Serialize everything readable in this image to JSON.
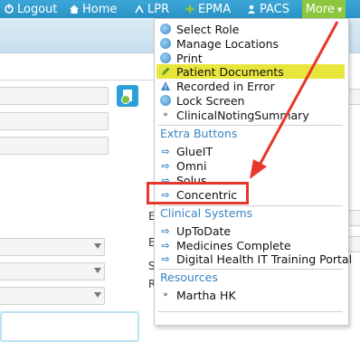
{
  "topnav": {
    "items": [
      {
        "label": "Logout",
        "icon": "logout-icon"
      },
      {
        "label": "Home",
        "icon": "home-icon"
      },
      {
        "label": "LPR",
        "icon": "lpr-icon"
      },
      {
        "label": "EPMA",
        "icon": "plus-icon"
      },
      {
        "label": "PACS",
        "icon": "pacs-icon"
      }
    ],
    "more_label": "More"
  },
  "background": {
    "letters": [
      "E",
      "E",
      "S",
      "R"
    ]
  },
  "menu": {
    "items": [
      {
        "label": "Select Role",
        "icon": "role-icon"
      },
      {
        "label": "Manage Locations",
        "icon": "locations-icon"
      },
      {
        "label": "Print",
        "icon": "print-icon"
      },
      {
        "label": "Patient Documents",
        "icon": "pencil-icon",
        "highlighted": true
      },
      {
        "label": "Recorded in Error",
        "icon": "warning-icon"
      },
      {
        "label": "Lock Screen",
        "icon": "lock-icon"
      },
      {
        "label": "ClinicalNotingSummary",
        "icon": "bullet-icon"
      }
    ],
    "sections": [
      {
        "title": "Extra Buttons",
        "items": [
          {
            "label": "GlueIT",
            "icon": "link-icon"
          },
          {
            "label": "Omni",
            "icon": "link-icon"
          },
          {
            "label": "Solus",
            "icon": "link-icon"
          },
          {
            "label": "Concentric",
            "icon": "link-icon",
            "annotated": true
          }
        ]
      },
      {
        "title": "Clinical Systems",
        "items": [
          {
            "label": "UpToDate",
            "icon": "link-icon"
          },
          {
            "label": "Medicines Complete",
            "icon": "link-icon"
          },
          {
            "label": "Digital Health IT Training Portal",
            "icon": "link-icon"
          }
        ]
      },
      {
        "title": "Resources",
        "items": [
          {
            "label": "Martha HK",
            "icon": "bullet-icon"
          }
        ]
      }
    ]
  },
  "colors": {
    "topbar": "#2a93c6",
    "more": "#8cc63f",
    "highlight": "#e8e63c",
    "section": "#3a84c4",
    "annotation": "#e8372a"
  }
}
